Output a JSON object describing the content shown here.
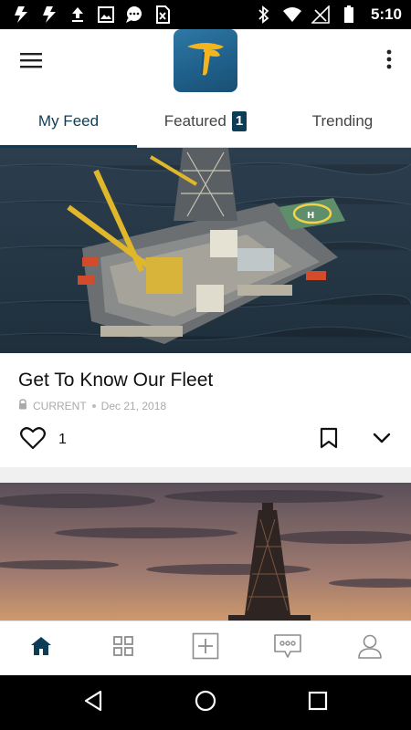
{
  "status_bar": {
    "time": "5:10",
    "left_icons": [
      "flash-icon",
      "flash-icon",
      "upload-icon",
      "image-icon",
      "chat-icon",
      "sim-icon"
    ],
    "right_icons": [
      "bluetooth-icon",
      "wifi-icon",
      "no-signal-icon",
      "battery-icon"
    ]
  },
  "app_bar": {
    "menu_icon": "hamburger-menu-icon",
    "logo_icon": "transocean-logo-icon",
    "more_icon": "more-vertical-icon",
    "colors": {
      "logo_bg": "#1e5f89",
      "logo_mark": "#f2b51f"
    }
  },
  "tabs": {
    "items": [
      {
        "label": "My Feed",
        "active": true
      },
      {
        "label": "Featured",
        "badge": "1",
        "active": false
      },
      {
        "label": "Trending",
        "active": false
      }
    ],
    "accent": "#0d3d56"
  },
  "feed": {
    "cards": [
      {
        "image": "offshore-rig-aerial",
        "title": "Get To Know Our Fleet",
        "lock_icon": "lock-icon",
        "channel": "CURRENT",
        "date": "Dec 21, 2018",
        "likes": "1",
        "like_icon": "heart-icon",
        "bookmark_icon": "bookmark-icon",
        "expand_icon": "chevron-down-icon"
      },
      {
        "image": "rig-sunset"
      }
    ]
  },
  "bottom_nav": {
    "items": [
      {
        "icon": "home-icon",
        "active": true
      },
      {
        "icon": "grid-icon",
        "active": false
      },
      {
        "icon": "add-icon",
        "active": false
      },
      {
        "icon": "chat-bubble-icon",
        "active": false
      },
      {
        "icon": "profile-icon",
        "active": false
      }
    ]
  },
  "system_nav": {
    "icons": [
      "back-icon",
      "home-circle-icon",
      "recents-icon"
    ]
  }
}
